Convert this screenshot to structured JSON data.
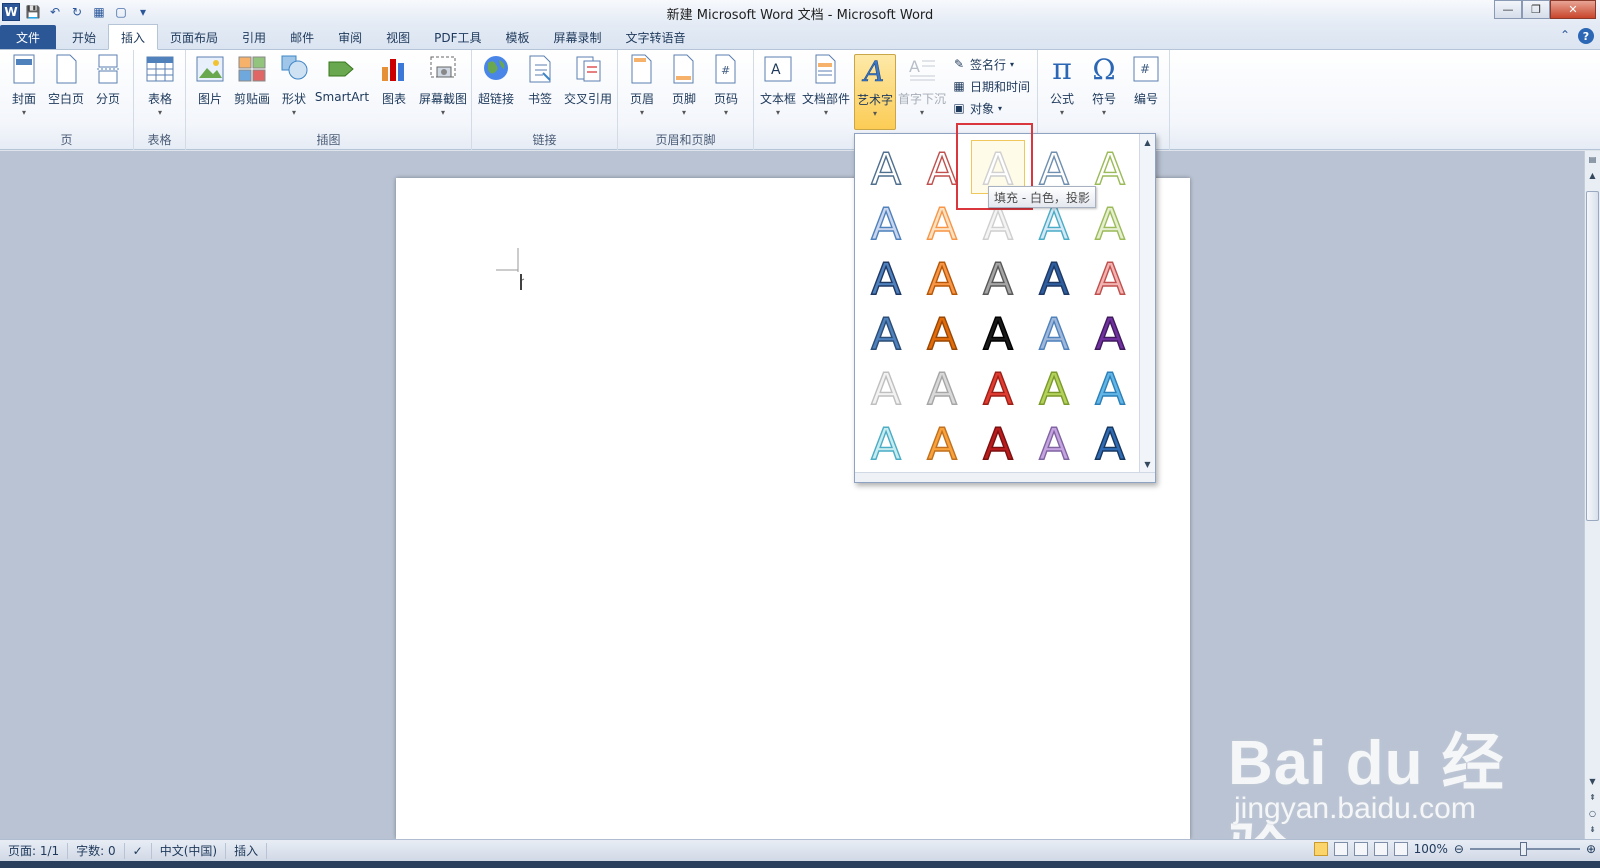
{
  "window": {
    "title": "新建 Microsoft Word 文档 - Microsoft Word",
    "logo_letter": "W"
  },
  "tabs": [
    {
      "label": "文件"
    },
    {
      "label": "开始"
    },
    {
      "label": "插入"
    },
    {
      "label": "页面布局"
    },
    {
      "label": "引用"
    },
    {
      "label": "邮件"
    },
    {
      "label": "审阅"
    },
    {
      "label": "视图"
    },
    {
      "label": "PDF工具"
    },
    {
      "label": "模板"
    },
    {
      "label": "屏幕录制"
    },
    {
      "label": "文字转语音"
    }
  ],
  "ribbon": {
    "groups": {
      "pages": {
        "label": "页",
        "cover": "封面",
        "blank": "空白页",
        "break": "分页"
      },
      "tables": {
        "label": "表格",
        "table": "表格"
      },
      "illustrations": {
        "label": "插图",
        "picture": "图片",
        "clipart": "剪贴画",
        "shapes": "形状",
        "smartart": "SmartArt",
        "chart": "图表",
        "screenshot": "屏幕截图"
      },
      "links": {
        "label": "链接",
        "hyperlink": "超链接",
        "bookmark": "书签",
        "crossref": "交叉引用"
      },
      "header_footer": {
        "label": "页眉和页脚",
        "header": "页眉",
        "footer": "页脚",
        "page_number": "页码"
      },
      "text": {
        "textbox": "文本框",
        "quickparts": "文档部件",
        "wordart": "艺术字",
        "dropcap": "首字下沉",
        "signature": "签名行",
        "datetime": "日期和时间",
        "object": "对象"
      },
      "symbols": {
        "equation": "公式",
        "symbol": "符号",
        "numbering": "编号"
      }
    }
  },
  "wordart": {
    "tooltip": "填充 - 白色，投影",
    "styles": [
      {
        "fill": "#ffffff",
        "stroke": "#4f6f8f"
      },
      {
        "fill": "#ffffff",
        "stroke": "#c0504d"
      },
      {
        "fill": "#ffffff",
        "stroke": "#d0d0d0"
      },
      {
        "fill": "#ffffff",
        "stroke": "#6f8fb0"
      },
      {
        "fill": "#ffffff",
        "stroke": "#9bbb59"
      },
      {
        "fill": "#c9d6ee",
        "stroke": "#4f81bd"
      },
      {
        "fill": "#fde3c4",
        "stroke": "#f79646"
      },
      {
        "fill": "#f4f4f4",
        "stroke": "#cfcfcf"
      },
      {
        "fill": "#d6e8f6",
        "stroke": "#4bacc6"
      },
      {
        "fill": "#e6efd2",
        "stroke": "#9bbb59"
      },
      {
        "fill": "#4f81bd",
        "stroke": "#1f3864"
      },
      {
        "fill": "#f79646",
        "stroke": "#b65708"
      },
      {
        "fill": "#a6a6a6",
        "stroke": "#595959"
      },
      {
        "fill": "#2e5e9e",
        "stroke": "#1f3864"
      },
      {
        "fill": "#f2b4b2",
        "stroke": "#c0504d"
      },
      {
        "fill": "#4f81bd",
        "stroke": "#2c4d75"
      },
      {
        "fill": "#e36c09",
        "stroke": "#974706"
      },
      {
        "fill": "#1a1a1a",
        "stroke": "#000000"
      },
      {
        "fill": "#9fb8da",
        "stroke": "#4f81bd"
      },
      {
        "fill": "#7030a0",
        "stroke": "#3f1a5c"
      },
      {
        "fill": "#f2f2f2",
        "stroke": "#bfbfbf"
      },
      {
        "fill": "#d9d9d9",
        "stroke": "#a6a6a6"
      },
      {
        "fill": "#e03c31",
        "stroke": "#9c1f17"
      },
      {
        "fill": "#b3d15b",
        "stroke": "#7a9a2b"
      },
      {
        "fill": "#62b6e6",
        "stroke": "#2c7fb8"
      },
      {
        "fill": "#c6ecf0",
        "stroke": "#4bacc6"
      },
      {
        "fill": "#f9a23c",
        "stroke": "#c0701e"
      },
      {
        "fill": "#b81c1c",
        "stroke": "#7a0f0f"
      },
      {
        "fill": "#c5a3e0",
        "stroke": "#8064a2"
      },
      {
        "fill": "#2f6bb5",
        "stroke": "#17375e"
      }
    ]
  },
  "statusbar": {
    "page": "页面: 1/1",
    "words": "字数: 0",
    "language": "中文(中国)",
    "mode": "插入",
    "zoom": "100%"
  },
  "watermark": {
    "logo": "Bai du 经验",
    "url": "jingyan.baidu.com"
  }
}
